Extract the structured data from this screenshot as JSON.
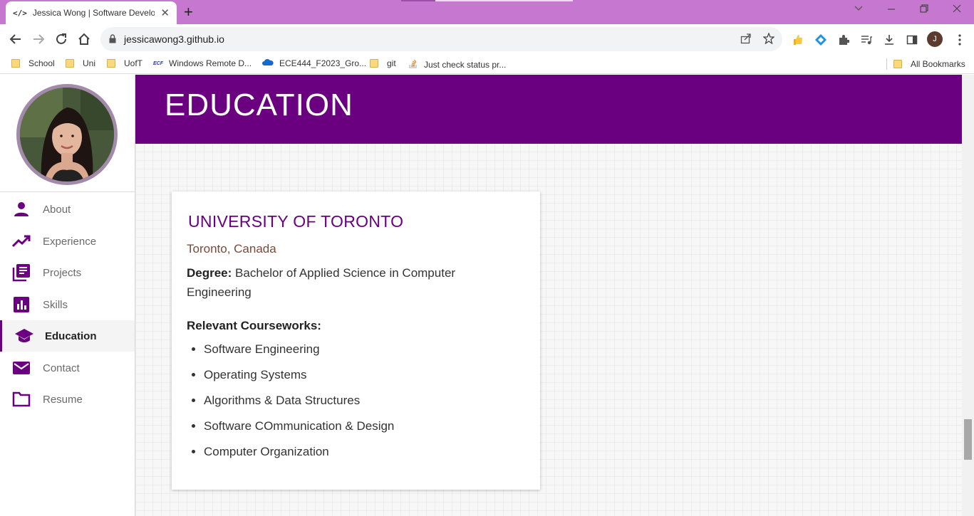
{
  "browser": {
    "tab_title": "Jessica Wong | Software Develop",
    "tab_favicon": "</>",
    "new_tab": "+",
    "url": "jessicawong3.github.io",
    "profile_initial": "J",
    "bookmarks": [
      {
        "label": "School",
        "icon": "folder-icon"
      },
      {
        "label": "Uni",
        "icon": "folder-icon"
      },
      {
        "label": "UofT",
        "icon": "folder-icon"
      },
      {
        "label": "Windows Remote D...",
        "icon": "ecf-icon"
      },
      {
        "label": "ECE444_F2023_Gro...",
        "icon": "onedrive-icon"
      },
      {
        "label": "git",
        "icon": "folder-icon"
      },
      {
        "label": "Just check status pr...",
        "icon": "stackoverflow-icon"
      }
    ],
    "all_bookmarks": "All Bookmarks",
    "ecf_badge": "ECF"
  },
  "sidebar": {
    "items": [
      {
        "label": "About",
        "icon": "person-icon"
      },
      {
        "label": "Experience",
        "icon": "trending-up-icon"
      },
      {
        "label": "Projects",
        "icon": "library-books-icon"
      },
      {
        "label": "Skills",
        "icon": "bar-chart-icon"
      },
      {
        "label": "Education",
        "icon": "graduation-cap-icon",
        "active": true
      },
      {
        "label": "Contact",
        "icon": "mail-icon"
      },
      {
        "label": "Resume",
        "icon": "folder-outline-icon"
      }
    ]
  },
  "main": {
    "banner_title": "EDUCATION",
    "card": {
      "school": "UNIVERSITY OF TORONTO",
      "location": "Toronto, Canada",
      "degree_label": "Degree:",
      "degree_value": "Bachelor of Applied Science in Computer Engineering",
      "courseworks_title": "Relevant Courseworks:",
      "courseworks": [
        "Software Engineering",
        "Operating Systems",
        "Algorithms & Data Structures",
        "Software COmmunication & Design",
        "Computer Organization"
      ]
    }
  },
  "colors": {
    "tabstrip": "#c678d0",
    "accent": "#6a0080",
    "location": "#7a4a3a"
  }
}
